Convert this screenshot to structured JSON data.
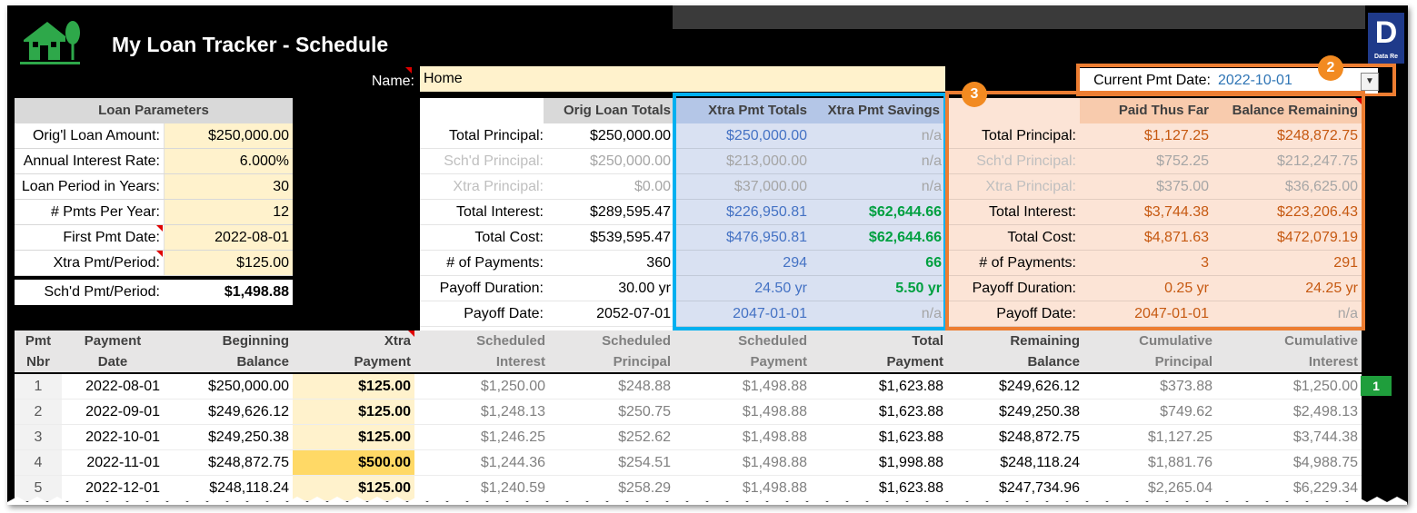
{
  "title": "My Loan Tracker - Schedule",
  "brand_letter": "D",
  "brand_sub": "Data Re",
  "name_label": "Name:",
  "name_value": "Home",
  "current_pmt_label": "Current Pmt Date:",
  "current_pmt_value": "2022-10-01",
  "callouts": [
    "1",
    "2",
    "3"
  ],
  "loan_params": {
    "header": "Loan Parameters",
    "rows": [
      {
        "label": "Orig'l Loan Amount:",
        "value": "$250,000.00"
      },
      {
        "label": "Annual Interest Rate:",
        "value": "6.000%"
      },
      {
        "label": "Loan Period in Years:",
        "value": "30"
      },
      {
        "label": "# Pmts Per Year:",
        "value": "12"
      },
      {
        "label": "First Pmt Date:",
        "value": "2022-08-01"
      },
      {
        "label": "Xtra Pmt/Period:",
        "value": "$125.00"
      }
    ],
    "sched_label": "Sch'd Pmt/Period:",
    "sched_value": "$1,498.88"
  },
  "summary": {
    "headers": {
      "orig": "Orig Loan Totals",
      "xtra": "Xtra Pmt Totals",
      "savings": "Xtra Pmt Savings",
      "paid": "Paid Thus Far",
      "balance": "Balance Remaining"
    },
    "rows": [
      {
        "label": "Total Principal:",
        "orig": "$250,000.00",
        "xtra": "$250,000.00",
        "savings": "n/a",
        "paid": "$1,127.25",
        "balance": "$248,872.75",
        "dim": false
      },
      {
        "label": "Sch'd Principal:",
        "orig": "$250,000.00",
        "xtra": "$213,000.00",
        "savings": "n/a",
        "paid": "$752.25",
        "balance": "$212,247.75",
        "dim": true
      },
      {
        "label": "Xtra Principal:",
        "orig": "$0.00",
        "xtra": "$37,000.00",
        "savings": "n/a",
        "paid": "$375.00",
        "balance": "$36,625.00",
        "dim": true
      },
      {
        "label": "Total Interest:",
        "orig": "$289,595.47",
        "xtra": "$226,950.81",
        "savings": "$62,644.66",
        "paid": "$3,744.38",
        "balance": "$223,206.43",
        "dim": false
      },
      {
        "label": "Total Cost:",
        "orig": "$539,595.47",
        "xtra": "$476,950.81",
        "savings": "$62,644.66",
        "paid": "$4,871.63",
        "balance": "$472,079.19",
        "dim": false
      },
      {
        "label": "# of Payments:",
        "orig": "360",
        "xtra": "294",
        "savings": "66",
        "paid": "3",
        "balance": "291",
        "dim": false
      },
      {
        "label": "Payoff Duration:",
        "orig": "30.00 yr",
        "xtra": "24.50 yr",
        "savings": "5.50 yr",
        "paid": "0.25 yr",
        "balance": "24.25 yr",
        "dim": false
      },
      {
        "label": "Payoff Date:",
        "orig": "2052-07-01",
        "xtra": "2047-01-01",
        "savings": "n/a",
        "paid": "2047-01-01",
        "balance": "n/a",
        "dim": false
      }
    ]
  },
  "schedule": {
    "headers": [
      [
        "Pmt",
        "Nbr"
      ],
      [
        "Payment",
        "Date"
      ],
      [
        "Beginning",
        "Balance"
      ],
      [
        "Xtra",
        "Payment"
      ],
      [
        "Scheduled",
        "Interest"
      ],
      [
        "Scheduled",
        "Principal"
      ],
      [
        "Scheduled",
        "Payment"
      ],
      [
        "Total",
        "Payment"
      ],
      [
        "Remaining",
        "Balance"
      ],
      [
        "Cumulative",
        "Principal"
      ],
      [
        "Cumulative",
        "Interest"
      ]
    ],
    "rows": [
      [
        "1",
        "2022-08-01",
        "$250,000.00",
        "$125.00",
        "$1,250.00",
        "$248.88",
        "$1,498.88",
        "$1,623.88",
        "$249,626.12",
        "$373.88",
        "$1,250.00"
      ],
      [
        "2",
        "2022-09-01",
        "$249,626.12",
        "$125.00",
        "$1,248.13",
        "$250.75",
        "$1,498.88",
        "$1,623.88",
        "$249,250.38",
        "$749.62",
        "$2,498.13"
      ],
      [
        "3",
        "2022-10-01",
        "$249,250.38",
        "$125.00",
        "$1,246.25",
        "$252.62",
        "$1,498.88",
        "$1,623.88",
        "$248,872.75",
        "$1,127.25",
        "$3,744.38"
      ],
      [
        "4",
        "2022-11-01",
        "$248,872.75",
        "$500.00",
        "$1,244.36",
        "$254.51",
        "$1,498.88",
        "$1,998.88",
        "$248,118.24",
        "$1,881.76",
        "$4,988.75"
      ],
      [
        "5",
        "2022-12-01",
        "$248,118.24",
        "$125.00",
        "$1,240.59",
        "$258.29",
        "$1,498.88",
        "$1,623.88",
        "$247,734.96",
        "$2,265.04",
        "$6,229.34"
      ]
    ]
  },
  "colors": {
    "input_fill": "#fff2cc",
    "xtra_highlight": "#ffd966",
    "blue_panel": "#d9e1f2",
    "blue_border": "#00b0f0",
    "orange_panel": "#fce4d6",
    "orange_border": "#ed7d31",
    "green_value": "#00a040",
    "blue_value": "#4472c4",
    "orange_value": "#c65911"
  }
}
